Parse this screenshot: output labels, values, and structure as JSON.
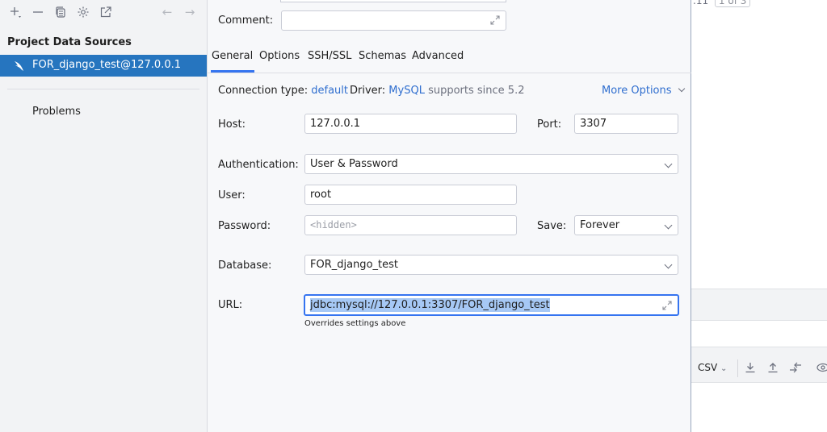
{
  "sidebar": {
    "section_title": "Project Data Sources",
    "datasource": {
      "label": "FOR_django_test@127.0.0.1",
      "icon": "dolphin-icon"
    },
    "problems_label": "Problems",
    "toolbar": {
      "add": "+",
      "remove": "—",
      "duplicate_icon": "copy-icon",
      "settings_icon": "gear-icon",
      "export_icon": "external-link-icon",
      "back": "←",
      "forward": "→"
    }
  },
  "dialog": {
    "comment_label": "Comment:",
    "comment_value": "",
    "tabs": [
      "General",
      "Options",
      "SSH/SSL",
      "Schemas",
      "Advanced"
    ],
    "active_tab": "General",
    "connection_type_label": "Connection type:",
    "connection_type_value": "default",
    "driver_label": "Driver:",
    "driver_value": "MySQL",
    "driver_note": "supports since 5.2",
    "more_options": "More Options",
    "host_label": "Host:",
    "host_value": "127.0.0.1",
    "port_label": "Port:",
    "port_value": "3307",
    "auth_label": "Authentication:",
    "auth_value": "User & Password",
    "user_label": "User:",
    "user_value": "root",
    "password_label": "Password:",
    "password_placeholder": "<hidden>",
    "save_label": "Save:",
    "save_value": "Forever",
    "database_label": "Database:",
    "database_value": "FOR_django_test",
    "url_label": "URL:",
    "url_value": "jdbc:mysql://127.0.0.1:3307/FOR_django_test",
    "url_note": "Overrides settings above"
  },
  "right_panel": {
    "top_text": ".11",
    "page_indicator": "1 of 3",
    "format_select": "CSV"
  },
  "colors": {
    "accent": "#3574f0",
    "selection": "#2675bf",
    "link": "#2f6ecf"
  }
}
